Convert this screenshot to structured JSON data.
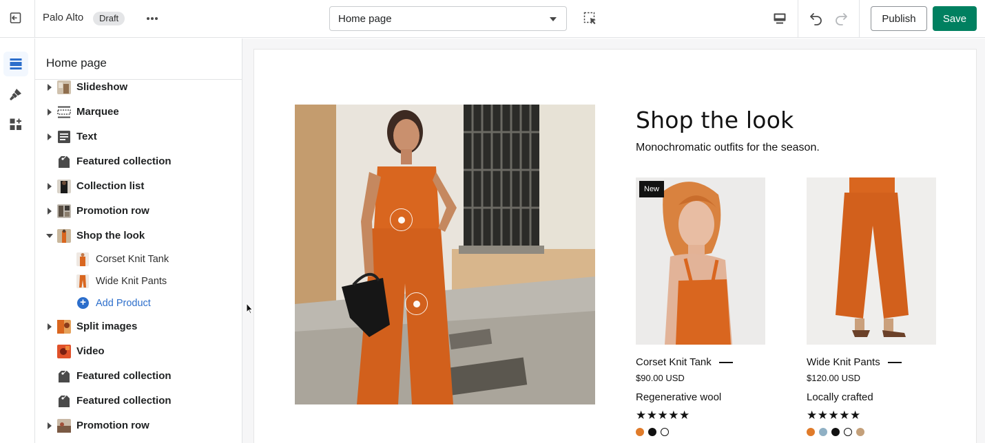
{
  "topbar": {
    "store_name": "Palo Alto",
    "status_badge": "Draft",
    "page_select_value": "Home page",
    "publish_label": "Publish",
    "save_label": "Save"
  },
  "rail": {
    "items": [
      {
        "icon": "sections-icon",
        "active": true
      },
      {
        "icon": "paint-brush-icon",
        "active": false
      },
      {
        "icon": "apps-icon",
        "active": false
      }
    ]
  },
  "sidebar": {
    "title": "Home page",
    "sections": [
      {
        "label": "Slideshow",
        "expandable": true,
        "icon": "image-thumb"
      },
      {
        "label": "Marquee",
        "expandable": true,
        "icon": "marquee-icon"
      },
      {
        "label": "Text",
        "expandable": true,
        "icon": "text-icon"
      },
      {
        "label": "Featured collection",
        "expandable": false,
        "icon": "tag-icon"
      },
      {
        "label": "Collection list",
        "expandable": true,
        "icon": "image-thumb"
      },
      {
        "label": "Promotion row",
        "expandable": true,
        "icon": "image-thumb"
      },
      {
        "label": "Shop the look",
        "expandable": true,
        "expanded": true,
        "icon": "image-thumb"
      },
      {
        "label": "Split images",
        "expandable": true,
        "icon": "image-thumb"
      },
      {
        "label": "Video",
        "expandable": false,
        "icon": "image-thumb"
      },
      {
        "label": "Featured collection",
        "expandable": false,
        "icon": "tag-icon"
      },
      {
        "label": "Featured collection",
        "expandable": false,
        "icon": "tag-icon"
      },
      {
        "label": "Promotion row",
        "expandable": true,
        "icon": "image-thumb"
      }
    ],
    "shop_the_look_blocks": [
      {
        "label": "Corset Knit Tank"
      },
      {
        "label": "Wide Knit Pants"
      }
    ],
    "add_product_label": "Add Product"
  },
  "preview": {
    "heading": "Shop the look",
    "subheading": "Monochromatic outfits for the season.",
    "products": [
      {
        "badge": "New",
        "name": "Corset Knit Tank",
        "price": "$90.00 USD",
        "feature": "Regenerative wool",
        "stars": "★★★★★",
        "swatches": [
          "#e07b2a",
          "#111111",
          "#ffffff"
        ]
      },
      {
        "badge": "",
        "name": "Wide Knit Pants",
        "price": "$120.00 USD",
        "feature": "Locally crafted",
        "stars": "★★★★★",
        "swatches": [
          "#e07b2a",
          "#8fb0c4",
          "#111111",
          "#ffffff",
          "#c4a07a"
        ]
      }
    ]
  },
  "colors": {
    "accent_green": "#008060",
    "link_blue": "#2c6ecb",
    "orange_outfit": "#d9661f"
  }
}
